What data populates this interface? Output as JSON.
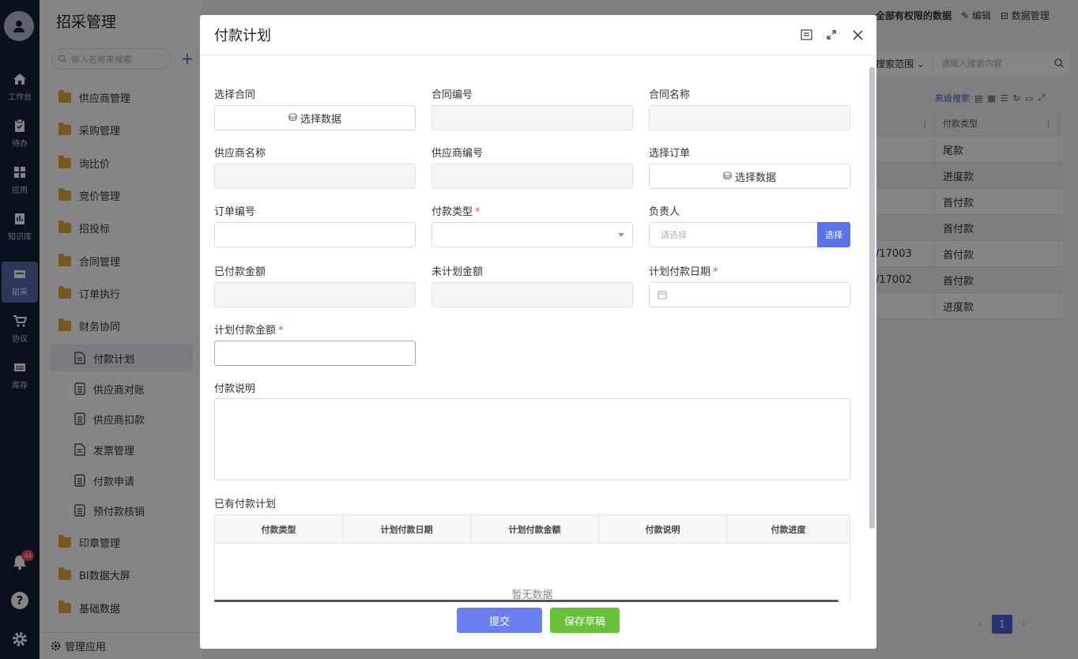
{
  "rail": {
    "items": [
      {
        "label": "工作台",
        "icon": "home-icon"
      },
      {
        "label": "待办",
        "icon": "clipboard-icon"
      },
      {
        "label": "应用",
        "icon": "apps-icon"
      },
      {
        "label": "知识库",
        "icon": "book-icon"
      },
      {
        "label": "招采",
        "icon": "procure-icon"
      },
      {
        "label": "协议",
        "icon": "cart-icon"
      },
      {
        "label": "库存",
        "icon": "warehouse-icon"
      }
    ],
    "notification_count": "44"
  },
  "sidebar": {
    "title": "招采管理",
    "search_placeholder": "输入名称来搜索",
    "items": [
      {
        "label": "供应商管理"
      },
      {
        "label": "采购管理"
      },
      {
        "label": "询比价"
      },
      {
        "label": "竞价管理"
      },
      {
        "label": "招投标"
      },
      {
        "label": "合同管理"
      },
      {
        "label": "订单执行"
      },
      {
        "label": "财务协同"
      },
      {
        "label": "付款计划"
      },
      {
        "label": "供应商对账"
      },
      {
        "label": "供应商扣款"
      },
      {
        "label": "发票管理"
      },
      {
        "label": "付款申请"
      },
      {
        "label": "预付款核销"
      },
      {
        "label": "印章管理"
      },
      {
        "label": "BI数据大屏"
      },
      {
        "label": "基础数据"
      }
    ],
    "manage_label": "管理应用"
  },
  "background": {
    "scope_label": "全部有权限的数据",
    "edit_label": "编辑",
    "data_manage_label": "数据管理",
    "search_scope": "搜索范围",
    "search_placeholder": "请输入搜索内容",
    "advanced_search": "高级搜索",
    "column_header": "付款类型",
    "rows": [
      {
        "code": "",
        "type": "尾款"
      },
      {
        "code": "",
        "type": "进度款"
      },
      {
        "code": "",
        "type": "首付款"
      },
      {
        "code": "",
        "type": "首付款"
      },
      {
        "code": "/17003",
        "type": "首付款"
      },
      {
        "code": "/17002",
        "type": "首付款"
      },
      {
        "code": "",
        "type": "进度款"
      }
    ],
    "page": "1"
  },
  "modal": {
    "title": "付款计划",
    "fields": {
      "select_contract": "选择合同",
      "contract_no": "合同编号",
      "contract_name": "合同名称",
      "supplier_name": "供应商名称",
      "supplier_no": "供应商编号",
      "select_order": "选择订单",
      "order_no": "订单编号",
      "pay_type": "付款类型",
      "owner": "负责人",
      "paid_amount": "已付款金额",
      "unplanned_amount": "未计划金额",
      "plan_date": "计划付款日期",
      "plan_amount": "计划付款金额",
      "description": "付款说明"
    },
    "required_mark": "*",
    "select_data_label": "选择数据",
    "owner_placeholder": "请选择",
    "pick_label": "选择",
    "existing_section": "已有付款计划",
    "table_columns": [
      "付款类型",
      "计划付款日期",
      "计划付款金额",
      "付款说明",
      "付款进度"
    ],
    "empty_text": "暂无数据",
    "submit_label": "提交",
    "draft_label": "保存草稿"
  },
  "colors": {
    "primary": "#5b73e8",
    "success": "#67c23a",
    "rail": "#13213c"
  }
}
